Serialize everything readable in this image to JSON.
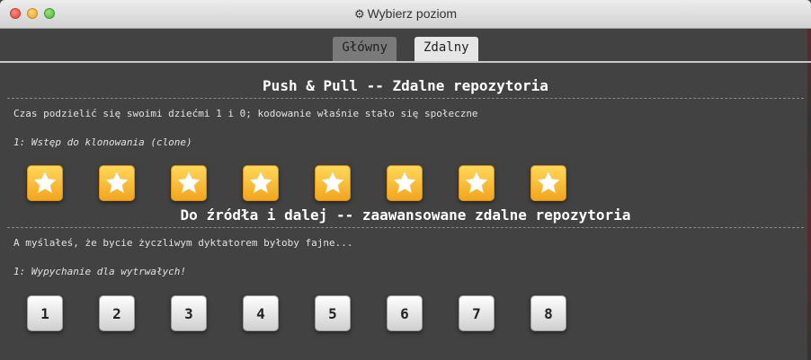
{
  "window": {
    "title": "Wybierz poziom",
    "title_icon": "gear-icon"
  },
  "tabs": [
    {
      "label": "Główny",
      "active": false
    },
    {
      "label": "Zdalny",
      "active": true
    }
  ],
  "sections": [
    {
      "title": "Push & Pull -- Zdalne repozytoria",
      "description": "Czas podzielić się swoimi dziećmi 1 i 0; kodowanie właśnie stało się społeczne",
      "subtitle": "1: Wstęp do klonowania (clone)",
      "levels": [
        "star-icon",
        "star-icon",
        "star-icon",
        "star-icon",
        "star-icon",
        "star-icon",
        "star-icon",
        "star-icon"
      ]
    },
    {
      "title": "Do źródła i dalej -- zaawansowane zdalne repozytoria",
      "description": "A myślałeś, że bycie życzliwym dyktatorem byłoby fajne...",
      "subtitle": "1: Wypychanie dla wytrwałych!",
      "levels": [
        "1",
        "2",
        "3",
        "4",
        "5",
        "6",
        "7",
        "8"
      ]
    }
  ],
  "colors": {
    "background": "#424242",
    "star_tile": "#f7b733",
    "number_tile": "#eeeeee"
  }
}
